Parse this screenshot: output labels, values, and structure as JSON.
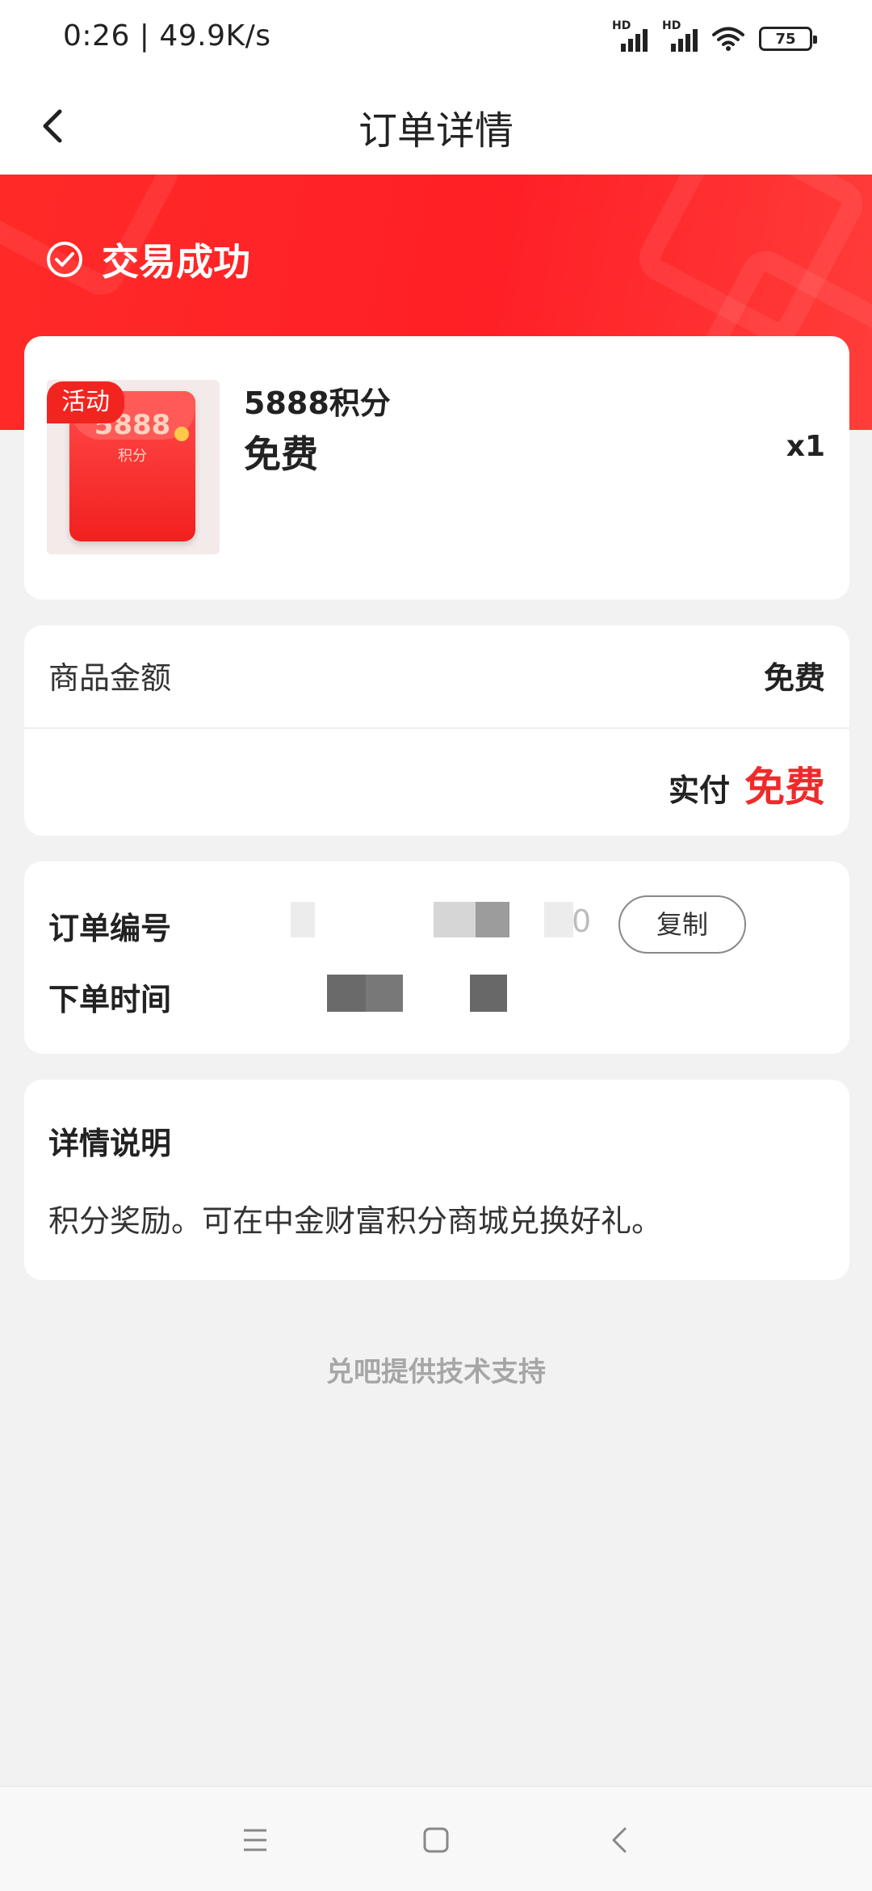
{
  "status_bar": {
    "time": "0:26 | 49.9K/s",
    "signal1_label": "HD",
    "signal2_label": "HD",
    "battery": "75"
  },
  "nav": {
    "title": "订单详情",
    "back_icon": "chevron-left-icon"
  },
  "banner": {
    "status": "交易成功",
    "status_icon": "check-circle-icon",
    "color": "#ff2a28"
  },
  "product": {
    "tag": "活动",
    "name": "5888积分",
    "price": "免费",
    "quantity": "x1",
    "image_amount": "5888",
    "image_unit": "积分"
  },
  "amount": {
    "goods_label": "商品金额",
    "goods_value": "免费",
    "paid_label": "实付",
    "paid_value": "免费",
    "accent": "#ee2b2b"
  },
  "order": {
    "number_label": "订单编号",
    "number_tail": "0",
    "time_label": "下单时间",
    "copy_label": "复制"
  },
  "details": {
    "title": "详情说明",
    "text": "积分奖励。可在中金财富积分商城兑换好礼。"
  },
  "footer": {
    "text": "兑吧提供技术支持"
  },
  "system_nav": {
    "menu_icon": "menu-icon",
    "home_icon": "home-square-icon",
    "back_icon": "back-chevron-icon"
  }
}
